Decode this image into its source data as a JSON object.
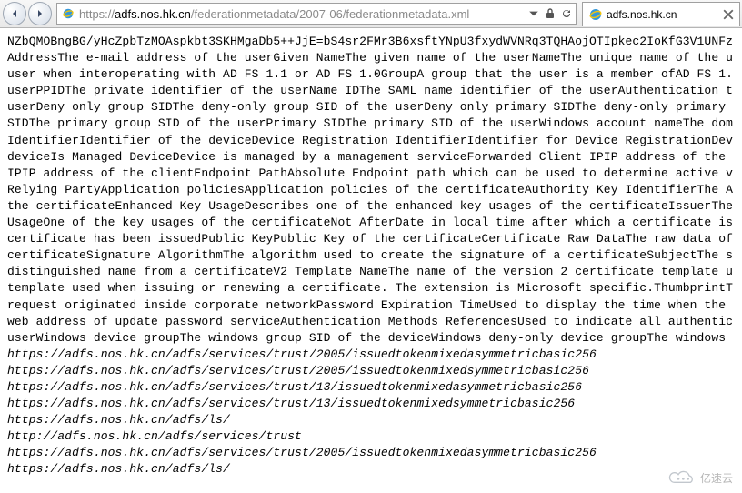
{
  "browser": {
    "url_scheme": "https://",
    "url_host": "adfs.nos.hk.cn",
    "url_path": "/federationmetadata/2007-06/federationmetadata.xml",
    "tab_title": "adfs.nos.hk.cn"
  },
  "content": {
    "line1": "NZbQMOBngBG/yHcZpbTzMOAspkbt3SKHMgaDb5++JjE=bS4sr2FMr3B6xsftYNpU3fxydWVNRq3TQHAojOTIpkec2IoKfG3V1UNFz",
    "line2": "AddressThe e-mail address of the userGiven NameThe given name of the userNameThe unique name of the u",
    "line3": "user when interoperating with AD FS 1.1 or AD FS 1.0GroupA group that the user is a member ofAD FS 1.",
    "line4": "userPPIDThe private identifier of the userName IDThe SAML name identifier of the userAuthentication t",
    "line5": "userDeny only group SIDThe deny-only group SID of the userDeny only primary SIDThe deny-only primary ",
    "line6": "SIDThe primary group SID of the userPrimary SIDThe primary SID of the userWindows account nameThe dom",
    "line7": "IdentifierIdentifier of the deviceDevice Registration IdentifierIdentifier for Device RegistrationDev",
    "line8": "deviceIs Managed DeviceDevice is managed by a management serviceForwarded Client IPIP address of the ",
    "line9": "IPIP address of the clientEndpoint PathAbsolute Endpoint path which can be used to determine active v",
    "line10": "Relying PartyApplication policiesApplication policies of the certificateAuthority Key IdentifierThe A",
    "line11": "the certificateEnhanced Key UsageDescribes one of the enhanced key usages of the certificateIssuerThe",
    "line12": "UsageOne of the key usages of the certificateNot AfterDate in local time after which a certificate is",
    "line13": "certificate has been issuedPublic KeyPublic Key of the certificateCertificate Raw DataThe raw data of",
    "line14": "certificateSignature AlgorithmThe algorithm used to create the signature of a certificateSubjectThe s",
    "line15": "distinguished name from a certificateV2 Template NameThe name of the version 2 certificate template u",
    "line16": "template used when issuing or renewing a certificate. The extension is Microsoft specific.ThumbprintT",
    "line17": "request originated inside corporate networkPassword Expiration TimeUsed to display the time when the ",
    "line18": "web address of update password serviceAuthentication Methods ReferencesUsed to indicate all authentic",
    "line19": "userWindows device groupThe windows group SID of the deviceWindows deny-only device groupThe windows ",
    "url1": "https://adfs.nos.hk.cn/adfs/services/trust/2005/issuedtokenmixedasymmetricbasic256",
    "url2": "https://adfs.nos.hk.cn/adfs/services/trust/2005/issuedtokenmixedsymmetricbasic256",
    "url3": "https://adfs.nos.hk.cn/adfs/services/trust/13/issuedtokenmixedasymmetricbasic256",
    "url4": "https://adfs.nos.hk.cn/adfs/services/trust/13/issuedtokenmixedsymmetricbasic256",
    "url5": "https://adfs.nos.hk.cn/adfs/ls/",
    "url6": "http://adfs.nos.hk.cn/adfs/services/trust",
    "url7": "https://adfs.nos.hk.cn/adfs/services/trust/2005/issuedtokenmixedasymmetricbasic256",
    "url8": "https://adfs.nos.hk.cn/adfs/ls/"
  },
  "watermark": "亿速云"
}
